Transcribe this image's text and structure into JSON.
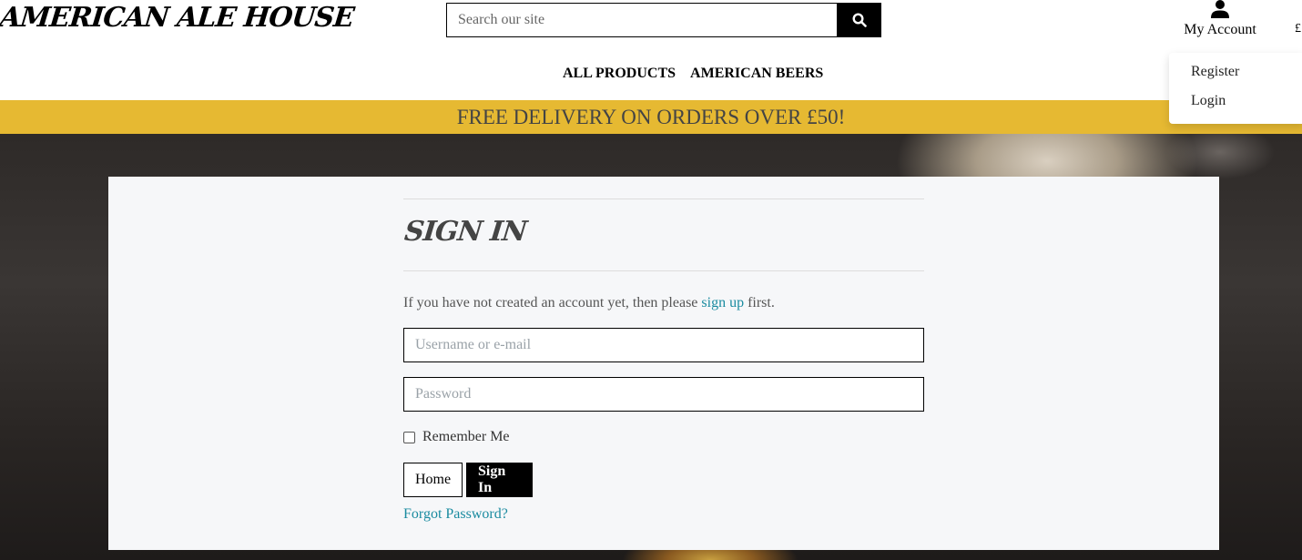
{
  "header": {
    "logo": "AMERICAN ALE HOUSE",
    "search_placeholder": "Search our site",
    "account_label": "My Account",
    "bag_peek": "£",
    "dropdown": [
      "Register",
      "Login"
    ]
  },
  "nav": [
    "ALL PRODUCTS",
    "AMERICAN BEERS"
  ],
  "banner": "FREE DELIVERY ON ORDERS OVER £50!",
  "signin": {
    "title": "SIGN IN",
    "intro_before": "If you have not created an account yet, then please ",
    "intro_link": "sign up",
    "intro_after": " first.",
    "username_placeholder": "Username or e-mail",
    "password_placeholder": "Password",
    "remember_label": "Remember Me",
    "home_button": "Home",
    "signin_button": "Sign In",
    "forgot_link": "Forgot Password?"
  },
  "colors": {
    "banner": "#e6b932",
    "link": "#1a8ba0",
    "panel": "#f6f7f9"
  }
}
